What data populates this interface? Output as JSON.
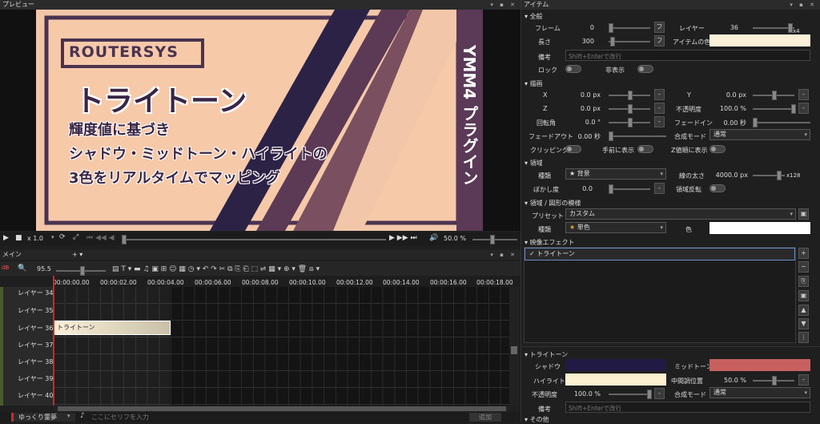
{
  "preview": {
    "title": "プレビュー",
    "brand": "ROUTERSYS",
    "heading": "トライトーン",
    "line1": "輝度値に基づき",
    "line2": "シャドウ・ミッドトーン・ハイライトの",
    "line3": "3色をリアルタイムでマッピング",
    "vertical": "YMM4 プラグイン",
    "speed": "x 1.0",
    "volume": "50.0 %"
  },
  "timeline": {
    "title": "メイン",
    "zoom": "95.5",
    "ticks": [
      "00:00:00.00",
      "00:00:02.00",
      "00:00:04.00",
      "00:00:06.00",
      "00:00:08.00",
      "00:00:10.00",
      "00:00:12.00",
      "00:00:14.00",
      "00:00:16.00",
      "00:00:18.00"
    ],
    "layers": [
      "レイヤー 34",
      "レイヤー 35",
      "レイヤー 36",
      "レイヤー 37",
      "レイヤー 38",
      "レイヤー 39",
      "レイヤー 40"
    ],
    "clip": "トライトーン",
    "bottom_label": "ゆっくり霊夢",
    "placeholder": "ここにセリフを入力",
    "add": "追加",
    "db": "dB"
  },
  "items": {
    "title": "アイテム",
    "general": "全般",
    "frame_label": "フレーム",
    "frame": "0",
    "layer_label": "レイヤー",
    "layer": "36",
    "layer_mult": "x4",
    "length_label": "長さ",
    "length": "300",
    "item_color_label": "アイテムの色",
    "note_label": "備考",
    "note_placeholder": "Shift+Enterで改行",
    "lock": "ロック",
    "hide": "非表示",
    "draw": "描画",
    "x_label": "X",
    "x": "0.0 px",
    "y_label": "Y",
    "y": "0.0 px",
    "z_label": "Z",
    "z": "0.0 px",
    "opacity_label": "不透明度",
    "opacity": "100.0 %",
    "rot_label": "回転角",
    "rot": "0.0 °",
    "fadein_label": "フェードイン",
    "fadein": "0.00 秒",
    "fadeout_label": "フェードアウト",
    "fadeout": "0.00 秒",
    "blend_label": "合成モード",
    "blend": "通常",
    "clip_label": "クリッピング",
    "front_label": "手前に表示",
    "zorder_label": "Z値順に表示",
    "area": "領域",
    "kind_label": "種類",
    "kind": "背景",
    "thick_label": "線の太さ",
    "thick": "4000.0 px",
    "thick_mult": "x128",
    "blur_label": "ぼかし度",
    "blur": "0.0",
    "invert_label": "領域反転",
    "area_shape": "領域 / 図形の模様",
    "preset_label": "プリセット",
    "preset": "カスタム",
    "kind2_label": "種類",
    "kind2": "単色",
    "color_label": "色",
    "effects": "映像エフェクト",
    "effect1": "トライトーン",
    "tritone": "トライトーン",
    "shadow_label": "シャドウ",
    "mid_label": "ミッドトーン",
    "high_label": "ハイライト",
    "midpos_label": "中間調位置",
    "midpos": "50.0 %",
    "op2_label": "不透明度",
    "op2": "100.0 %",
    "blend2_label": "合成モード",
    "blend2": "通常",
    "note2_label": "備考",
    "other": "その他"
  },
  "colors": {
    "shadow": "#211a44",
    "mid": "#c86060",
    "high": "#fbf0d0",
    "item": "#fbf0d8"
  }
}
